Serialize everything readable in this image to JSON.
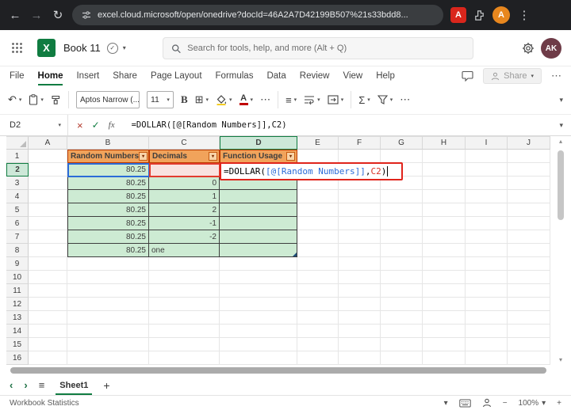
{
  "browser": {
    "url": "excel.cloud.microsoft/open/onedrive?docId=46A2A7D42199B507%21s33bdd8...",
    "pdf_badge": "A",
    "profile_initial": "A"
  },
  "app_header": {
    "title": "Book 11",
    "search_placeholder": "Search for tools, help, and more (Alt + Q)",
    "user_initials": "AK"
  },
  "ribbon": {
    "tabs": [
      "File",
      "Home",
      "Insert",
      "Share",
      "Page Layout",
      "Formulas",
      "Data",
      "Review",
      "View",
      "Help"
    ],
    "active_tab": "Home",
    "share_button": "Share",
    "font_name": "Aptos Narrow (...",
    "font_size": "11",
    "bold_label": "B",
    "font_color_label": "A"
  },
  "formula_bar": {
    "name_box": "D2",
    "fx": "fx",
    "formula": "=DOLLAR([@[Random Numbers]],C2)"
  },
  "sheet": {
    "column_headers": [
      "A",
      "B",
      "C",
      "D",
      "E",
      "F",
      "G",
      "H",
      "I",
      "J"
    ],
    "row_count": 16,
    "selected_cell": "D2",
    "selected_column": "D",
    "selected_row": 2,
    "table": {
      "headers": [
        "Random Numbers",
        "Decimals",
        "Function Usage"
      ],
      "rows": [
        {
          "random": "80.25",
          "decimals": "",
          "usage": ""
        },
        {
          "random": "80.25",
          "decimals": "0",
          "usage": ""
        },
        {
          "random": "80.25",
          "decimals": "1",
          "usage": ""
        },
        {
          "random": "80.25",
          "decimals": "2",
          "usage": ""
        },
        {
          "random": "80.25",
          "decimals": "-1",
          "usage": ""
        },
        {
          "random": "80.25",
          "decimals": "-2",
          "usage": ""
        },
        {
          "random": "80.25",
          "decimals": "one",
          "usage": ""
        }
      ]
    },
    "editing_cell": {
      "cell": "D2",
      "segments": [
        {
          "text": "=DOLLAR(",
          "color": "#000000"
        },
        {
          "text": "[@[Random Numbers]]",
          "color": "#2B6BD8"
        },
        {
          "text": ",",
          "color": "#000000"
        },
        {
          "text": "C2",
          "color": "#D93025"
        },
        {
          "text": ")",
          "color": "#000000"
        }
      ]
    }
  },
  "sheet_tabs": {
    "active_sheet": "Sheet1",
    "add_label": "+"
  },
  "status_bar": {
    "left": "Workbook Statistics",
    "zoom": "100%"
  },
  "icons": {
    "back": "←",
    "forward": "→",
    "refresh": "↻",
    "menu": "⋮",
    "chevron_down": "▾",
    "chevron_up": "▴",
    "undo": "↶",
    "borders": "⊞",
    "align": "≡",
    "more": "⋯",
    "sigma": "Σ",
    "close": "×",
    "check": "✓",
    "saved_check": "✓",
    "hamburger": "≡",
    "prev": "‹",
    "next": "›",
    "minus": "−",
    "plus": "+"
  },
  "colors": {
    "excel_green": "#107C41",
    "table_header_bg": "#F1A35B",
    "table_body_bg": "#CDEBD3",
    "ref_blue": "#2B6BD8",
    "ref_red": "#E23B2E",
    "annotation_red": "#E0241B"
  }
}
